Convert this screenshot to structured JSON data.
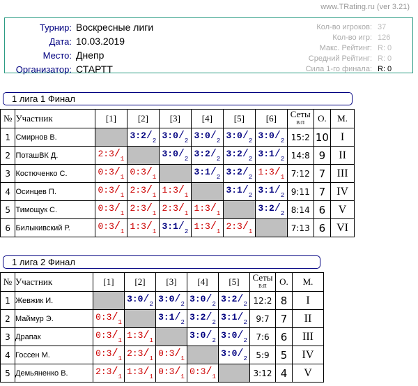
{
  "credit": "www.TRating.ru (ver 3.21)",
  "info": {
    "tournament_label": "Турнир:",
    "tournament": "Воскресные лиги",
    "date_label": "Дата:",
    "date": "10.03.2019",
    "place_label": "Место:",
    "place": "Днепр",
    "organizer_label": "Организатор:",
    "organizer": "СТАРТТ"
  },
  "stats": {
    "players_label": "Кол-во игроков:",
    "players": "37",
    "games_label": "Кол-во игр:",
    "games": "126",
    "max_label": "Макс. Рейтинг:",
    "max": "R:   0",
    "avg_label": "Средний Рейтинг:",
    "avg": "R:   0",
    "strength_label": "Сила 1-го финала:",
    "strength": "R:   0"
  },
  "headers": {
    "num": "№",
    "name": "Участник",
    "sets": "Сеты",
    "sets_sub": "В:П",
    "points": "О.",
    "place": "М."
  },
  "groups": [
    {
      "title": "1 лига 1 Финал",
      "cols": [
        "[1]",
        "[2]",
        "[3]",
        "[4]",
        "[5]",
        "[6]"
      ],
      "rows": [
        {
          "n": "1",
          "name": "Смирнов В.",
          "cells": [
            null,
            [
              "3:2",
              "2"
            ],
            [
              "3:0",
              "2"
            ],
            [
              "3:0",
              "2"
            ],
            [
              "3:0",
              "2"
            ],
            [
              "3:0",
              "2"
            ]
          ],
          "sets": "15:2",
          "points": "10",
          "place": "I"
        },
        {
          "n": "2",
          "name": "ПоташВК Д.",
          "cells": [
            [
              "2:3",
              "1"
            ],
            null,
            [
              "3:0",
              "2"
            ],
            [
              "3:2",
              "2"
            ],
            [
              "3:2",
              "2"
            ],
            [
              "3:1",
              "2"
            ]
          ],
          "sets": "14:8",
          "points": "9",
          "place": "II"
        },
        {
          "n": "3",
          "name": "Костюченко С.",
          "cells": [
            [
              "0:3",
              "1"
            ],
            [
              "0:3",
              "1"
            ],
            null,
            [
              "3:1",
              "2"
            ],
            [
              "3:2",
              "2"
            ],
            [
              "1:3",
              "1"
            ]
          ],
          "sets": "7:12",
          "points": "7",
          "place": "III"
        },
        {
          "n": "4",
          "name": "Осинцев П.",
          "cells": [
            [
              "0:3",
              "1"
            ],
            [
              "2:3",
              "1"
            ],
            [
              "1:3",
              "1"
            ],
            null,
            [
              "3:1",
              "2"
            ],
            [
              "3:1",
              "2"
            ]
          ],
          "sets": "9:11",
          "points": "7",
          "place": "IV"
        },
        {
          "n": "5",
          "name": "Тимощук С.",
          "cells": [
            [
              "0:3",
              "1"
            ],
            [
              "2:3",
              "1"
            ],
            [
              "2:3",
              "1"
            ],
            [
              "1:3",
              "1"
            ],
            null,
            [
              "3:2",
              "2"
            ]
          ],
          "sets": "8:14",
          "points": "6",
          "place": "V"
        },
        {
          "n": "6",
          "name": "Билыкивский Р.",
          "cells": [
            [
              "0:3",
              "1"
            ],
            [
              "1:3",
              "1"
            ],
            [
              "3:1",
              "2"
            ],
            [
              "1:3",
              "1"
            ],
            [
              "2:3",
              "1"
            ],
            null
          ],
          "sets": "7:13",
          "points": "6",
          "place": "VI"
        }
      ]
    },
    {
      "title": "1 лига 2 Финал",
      "cols": [
        "[1]",
        "[2]",
        "[3]",
        "[4]",
        "[5]"
      ],
      "rows": [
        {
          "n": "1",
          "name": "Жевжик И.",
          "cells": [
            null,
            [
              "3:0",
              "2"
            ],
            [
              "3:0",
              "2"
            ],
            [
              "3:0",
              "2"
            ],
            [
              "3:2",
              "2"
            ]
          ],
          "sets": "12:2",
          "points": "8",
          "place": "I"
        },
        {
          "n": "2",
          "name": "Маймур Э.",
          "cells": [
            [
              "0:3",
              "1"
            ],
            null,
            [
              "3:1",
              "2"
            ],
            [
              "3:2",
              "2"
            ],
            [
              "3:1",
              "2"
            ]
          ],
          "sets": "9:7",
          "points": "7",
          "place": "II"
        },
        {
          "n": "3",
          "name": "Драпак",
          "cells": [
            [
              "0:3",
              "1"
            ],
            [
              "1:3",
              "1"
            ],
            null,
            [
              "3:0",
              "2"
            ],
            [
              "3:0",
              "2"
            ]
          ],
          "sets": "7:6",
          "points": "6",
          "place": "III"
        },
        {
          "n": "4",
          "name": "Госсен М.",
          "cells": [
            [
              "0:3",
              "1"
            ],
            [
              "2:3",
              "1"
            ],
            [
              "0:3",
              "1"
            ],
            null,
            [
              "3:0",
              "2"
            ]
          ],
          "sets": "5:9",
          "points": "5",
          "place": "IV"
        },
        {
          "n": "5",
          "name": "Демьяненко В.",
          "cells": [
            [
              "2:3",
              "1"
            ],
            [
              "1:3",
              "1"
            ],
            [
              "0:3",
              "1"
            ],
            [
              "0:3",
              "1"
            ],
            null
          ],
          "sets": "3:12",
          "points": "4",
          "place": "V"
        }
      ]
    }
  ]
}
